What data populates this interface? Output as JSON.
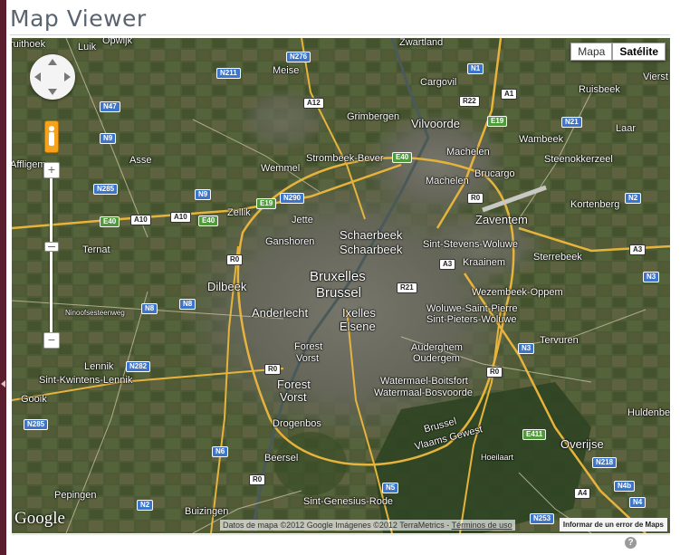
{
  "page": {
    "title": "Map Viewer"
  },
  "map": {
    "map_types": {
      "map_label": "Mapa",
      "satellite_label": "Satélite",
      "active": "satellite"
    },
    "google_logo": "Google",
    "attribution_text": "Datos de mapa ©2012 Google Imágenes ©2012 TerraMetrics - ",
    "terms_link": "Términos de uso",
    "report_error": "Informar de un error de Maps",
    "zoom_in": "+",
    "zoom_out": "−",
    "places": {
      "bruithoek": "ruithoek",
      "luik": "Luik",
      "opwijk": "Opwijk",
      "zwartland": "Zwartland",
      "meise": "Meise",
      "cargovil": "Cargovil",
      "ruisbeek": "Ruisbeek",
      "vierst": "Vierst",
      "grimbergen": "Grimbergen",
      "vilvoorde": "Vilvoorde",
      "laar": "Laar",
      "asse": "Asse",
      "machelen1": "Machelen",
      "wambeek": "Wambeek",
      "affligem": "Affligem",
      "strombeek": "Strombeek-Bever",
      "steenokkerzeel": "Steenokkerzeel",
      "wemmel": "Wemmel",
      "brucargo": "Brucargo",
      "machelen2": "Machelen",
      "zellik": "Zellik",
      "kortenberg": "Kortenberg",
      "jette": "Jette",
      "zaventem": "Zaventem",
      "ternat": "Ternat",
      "ganshoren": "Ganshoren",
      "schaerbeek1": "Schaerbeek",
      "schaarbeek": "Schaarbeek",
      "sint_stevens": "Sint-Stevens-Woluwe",
      "kraainem": "Kraainem",
      "sterrebeek": "Sterrebeek",
      "bruxelles": "Bruxelles",
      "brussel": "Brussel",
      "dilbeek": "Dilbeek",
      "wezembeek": "Wezembeek-Oppem",
      "ninoofse": "Ninoofsesteenweg",
      "anderlecht": "Anderlecht",
      "ixelles": "Ixelles",
      "elsene": "Elsene",
      "wsp1": "Woluwe-Saint-Pierre",
      "wsp2": "Sint-Pieters-Woluwe",
      "tervuren": "Tervuren",
      "forest1": "Forest",
      "vorst1": "Vorst",
      "auderghem": "Auderghem",
      "oudergem": "Oudergem",
      "lennik": "Lennik",
      "sint_kwintens": "Sint-Kwintens-Lennik",
      "forest2": "Forest",
      "vorst2": "Vorst",
      "watermael1": "Watermael-Boitsfort",
      "watermael2": "Watermaal-Bosvoorde",
      "gooik": "Gooik",
      "huldenberg": "Huldenberg",
      "drogenbos": "Drogenbos",
      "brussel_forest": "Brussel",
      "vlaams_gewest": "Vlaams Gewest",
      "overijse": "Overijse",
      "hoeilaart": "Hoeilaart",
      "beersel": "Beersel",
      "pepingen": "Pepingen",
      "sint_genesius": "Sint-Genesius-Rode",
      "buizingen": "Buizingen"
    },
    "shields": {
      "n276": "N276",
      "n211": "N211",
      "n1": "N1",
      "a12": "A12",
      "r22": "R22",
      "a1": "A1",
      "n47": "N47",
      "e19a": "E19",
      "n21": "N21",
      "n9a": "N9",
      "e40a": "E40",
      "n285a": "N285",
      "n9b": "N9",
      "n290": "N290",
      "r0a": "R0",
      "n2": "N2",
      "e19b": "E19",
      "e40b": "E40",
      "a10a": "A10",
      "a10b": "A10",
      "e40c": "E40",
      "r0b": "R0",
      "a3a": "A3",
      "a3b": "A3",
      "n3a": "N3",
      "r21": "R21",
      "n8a": "N8",
      "n8b": "N8",
      "n282": "N282",
      "r0c": "R0",
      "n3b": "N3",
      "r0d": "R0",
      "n285b": "N285",
      "n6": "N6",
      "e411": "E411",
      "n218": "N218",
      "r0e": "R0",
      "n5": "N5",
      "n4b": "N4b",
      "n253": "N253",
      "a4": "A4",
      "n4": "N4",
      "n2b": "N2"
    }
  },
  "colors": {
    "sidebar": "#5a1e2e",
    "title_text": "#5a6470",
    "road_major": "#e6b33c",
    "road_minor": "#c8c0a0",
    "urban": "#6f6f62"
  }
}
